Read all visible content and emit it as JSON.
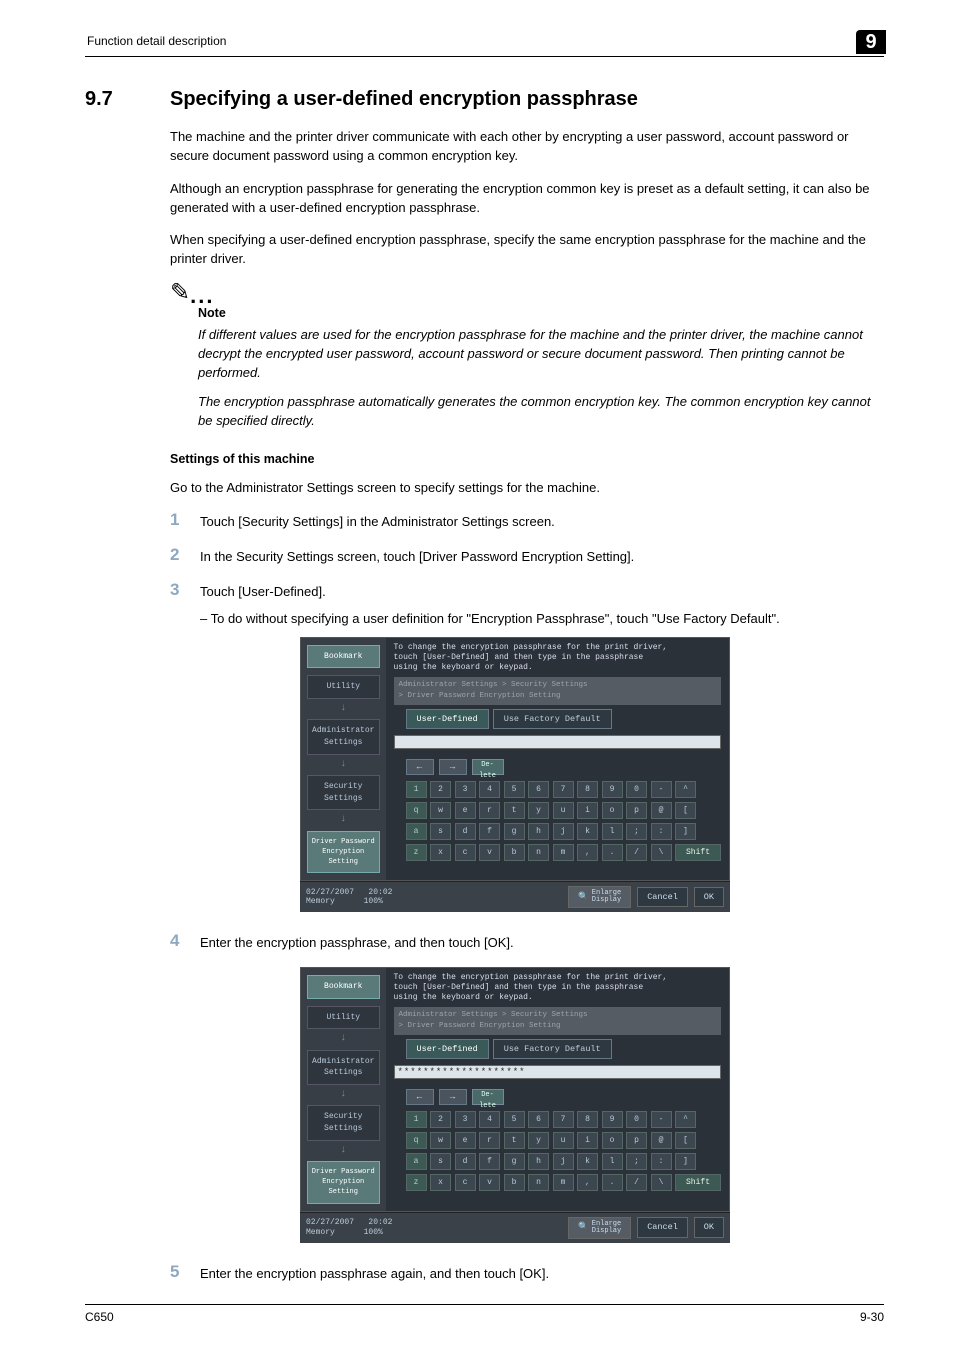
{
  "header": {
    "left": "Function detail description",
    "chapter": "9"
  },
  "section": {
    "number": "9.7",
    "title": "Specifying a user-defined encryption passphrase"
  },
  "paragraphs": {
    "p1": "The machine and the printer driver communicate with each other by encrypting a user password, account password or secure document password using a common encryption key.",
    "p2": "Although an encryption passphrase for generating the encryption common key is preset as a default setting, it can also be generated with a user-defined encryption passphrase.",
    "p3": "When specifying a user-defined encryption passphrase, specify the same encryption passphrase for the machine and the printer driver."
  },
  "note": {
    "label": "Note",
    "b1": "If different values are used for the encryption passphrase for the machine and the printer driver, the machine cannot decrypt the encrypted user password, account password or secure document password. Then printing cannot be performed.",
    "b2": "The encryption passphrase automatically generates the common encryption key. The common encryption key cannot be specified directly."
  },
  "sub": {
    "heading": "Settings of this machine",
    "intro": "Go to the Administrator Settings screen to specify settings for the machine."
  },
  "steps": {
    "s1": "Touch [Security Settings] in the Administrator Settings screen.",
    "s2": "In the Security Settings screen, touch [Driver Password Encryption Setting].",
    "s3": "Touch [User-Defined].",
    "s3sub": "–   To do without specifying a user definition for \"Encryption Passphrase\", touch \"Use Factory Default\".",
    "s4": "Enter the encryption passphrase, and then touch [OK].",
    "s5": "Enter the encryption passphrase again, and then touch [OK]."
  },
  "screen": {
    "instr": "To change the encryption passphrase for the print driver,\ntouch [User-Defined] and then type in the passphrase\nusing the keyboard or keypad.",
    "breadcrumb": "Administrator Settings > Security Settings\n> Driver Password Encryption Setting",
    "side": {
      "bookmark": "Bookmark",
      "utility": "Utility",
      "admin": "Administrator\nSettings",
      "security": "Security\nSettings",
      "driver": "Driver Password\nEncryption\nSetting"
    },
    "tabs": {
      "user": "User-Defined",
      "factory": "Use Factory Default"
    },
    "delete": "De-\nlete",
    "rows": {
      "r1": [
        "1",
        "2",
        "3",
        "4",
        "5",
        "6",
        "7",
        "8",
        "9",
        "0",
        "-",
        "^"
      ],
      "r2": [
        "q",
        "w",
        "e",
        "r",
        "t",
        "y",
        "u",
        "i",
        "o",
        "p",
        "@",
        "["
      ],
      "r3": [
        "a",
        "s",
        "d",
        "f",
        "g",
        "h",
        "j",
        "k",
        "l",
        ";",
        ":",
        "]"
      ],
      "r4": [
        "z",
        "x",
        "c",
        "v",
        "b",
        "n",
        "m",
        ",",
        ".",
        "/",
        "\\"
      ]
    },
    "shift": "Shift",
    "bottom": {
      "date": "02/27/2007",
      "time": "20:02",
      "mem": "Memory",
      "pct": "100%",
      "enlarge": "Enlarge\nDisplay",
      "cancel": "Cancel",
      "ok": "OK"
    },
    "filled": "********************"
  },
  "footer": {
    "left": "C650",
    "right": "9-30"
  }
}
